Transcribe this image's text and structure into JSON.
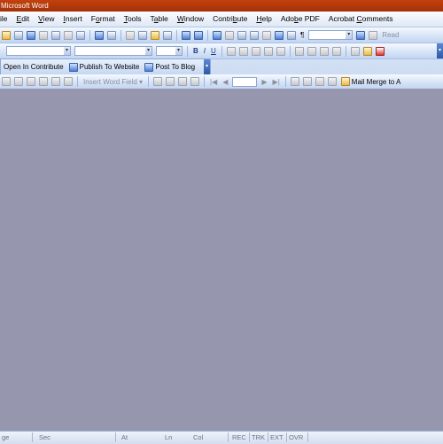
{
  "window": {
    "title": "Microsoft Word"
  },
  "menu": [
    {
      "label": "ile",
      "accel": ""
    },
    {
      "label": "Edit",
      "accel": "E"
    },
    {
      "label": "View",
      "accel": "V"
    },
    {
      "label": "Insert",
      "accel": "I"
    },
    {
      "label": "Format",
      "accel": "o"
    },
    {
      "label": "Tools",
      "accel": "T"
    },
    {
      "label": "Table",
      "accel": "a"
    },
    {
      "label": "Window",
      "accel": "W"
    },
    {
      "label": "Contribute",
      "accel": "b"
    },
    {
      "label": "Help",
      "accel": "H"
    },
    {
      "label": "Adobe PDF",
      "accel": "b"
    },
    {
      "label": "Acrobat Comments",
      "accel": "C"
    }
  ],
  "toolbar_standard": {
    "zoom_value": "",
    "read_label": "Read",
    "pilcrow": "¶"
  },
  "toolbar_formatting": {
    "style_value": "",
    "font_value": "",
    "size_value": "",
    "bold": "B",
    "italic": "I",
    "underline": "U"
  },
  "toolbar_contribute": {
    "open_label": "Open In Contribute",
    "publish_label": "Publish To Website",
    "blog_label": "Post To Blog"
  },
  "toolbar_mailmerge": {
    "insert_field_label": "Insert Word Field ▾",
    "record_value": "",
    "mail_merge_label": "Mail Merge to A"
  },
  "statusbar": {
    "page": "ge",
    "sec": "Sec",
    "at": "At",
    "ln": "Ln",
    "col": "Col",
    "rec": "REC",
    "trk": "TRK",
    "ext": "EXT",
    "ovr": "OVR"
  },
  "colors": {
    "title_bar": "#b4390a",
    "document_area": "#9696af",
    "toolbar": "#d4e2f6"
  }
}
